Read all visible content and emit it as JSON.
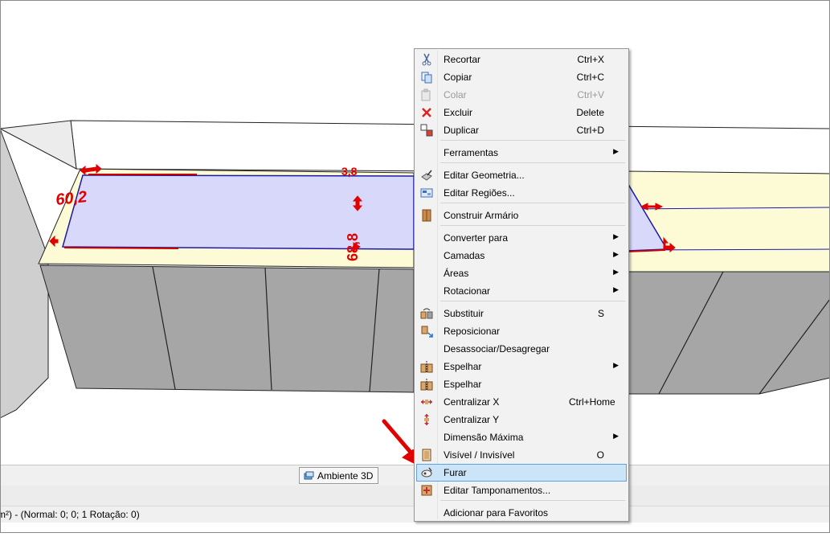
{
  "scene": {
    "dimension_labels": [
      "60,2",
      "3,8",
      "68,8"
    ],
    "tab_label": "Ambiente 3D",
    "status_text": "m²) - (Normal: 0; 0; 1 Rotação: 0)"
  },
  "context_menu": {
    "items": [
      {
        "label": "Recortar",
        "shortcut": "Ctrl+X",
        "icon": "scissors-icon"
      },
      {
        "label": "Copiar",
        "shortcut": "Ctrl+C",
        "icon": "copy-icon"
      },
      {
        "label": "Colar",
        "shortcut": "Ctrl+V",
        "icon": "paste-icon",
        "disabled": true
      },
      {
        "label": "Excluir",
        "shortcut": "Delete",
        "icon": "delete-x-icon"
      },
      {
        "label": "Duplicar",
        "shortcut": "Ctrl+D",
        "icon": "duplicate-icon"
      },
      {
        "label": "Ferramentas",
        "submenu": true
      },
      {
        "label": "Editar Geometria...",
        "icon": "geometry-icon"
      },
      {
        "label": "Editar Regiões...",
        "icon": "regions-icon"
      },
      {
        "label": "Construir Armário",
        "icon": "cabinet-icon"
      },
      {
        "label": "Converter para",
        "submenu": true
      },
      {
        "label": "Camadas",
        "submenu": true
      },
      {
        "label": "Áreas",
        "submenu": true
      },
      {
        "label": "Rotacionar",
        "submenu": true
      },
      {
        "label": "Substituir",
        "shortcut": "S",
        "icon": "substitute-icon"
      },
      {
        "label": "Reposicionar",
        "icon": "reposition-icon"
      },
      {
        "label": "Desassociar/Desagregar"
      },
      {
        "label": "Espelhar",
        "submenu": true,
        "icon": "mirror-icon"
      },
      {
        "label": "Espelhar",
        "icon": "mirror-icon"
      },
      {
        "label": "Centralizar X",
        "shortcut": "Ctrl+Home",
        "icon": "center-x-icon"
      },
      {
        "label": "Centralizar Y",
        "icon": "center-y-icon"
      },
      {
        "label": "Dimensão Máxima",
        "submenu": true
      },
      {
        "label": "Visível / Invisível",
        "shortcut": "O",
        "icon": "visibility-icon"
      },
      {
        "label": "Furar",
        "icon": "drill-icon",
        "highlighted": true
      },
      {
        "label": "Editar Tamponamentos...",
        "icon": "cover-panel-icon"
      },
      {
        "label": "Adicionar para Favoritos"
      }
    ]
  },
  "colors": {
    "selection_fill": "#d8d8fb",
    "countertop": "#fdfbd6",
    "cabinet": "#a9a9a9",
    "dimension_red": "#e00000",
    "menu_highlight": "#cce4f7"
  }
}
